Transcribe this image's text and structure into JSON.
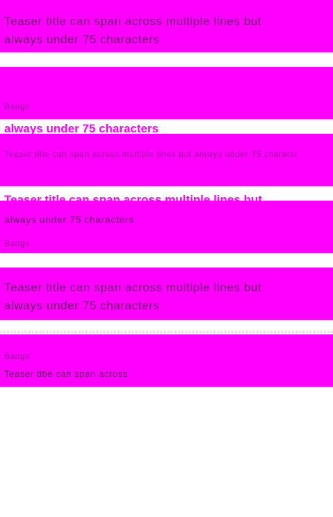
{
  "colors": {
    "accent": "#ff00ff",
    "background": "#ffffff",
    "text": "#111111"
  },
  "teasers": {
    "t1": {
      "line1": "Teaser title can span across multiple lines but",
      "line2": "always under 75 characters"
    },
    "t2": {
      "meta": "Badge"
    },
    "t3": {
      "line1": "always under 75 characters",
      "line2": "Teaser title can span across multiple lines but always under 75 characters"
    },
    "t4": {
      "line1": "Teaser title can span across multiple lines but",
      "line2": "always under 75 characters",
      "meta": "Badge"
    },
    "t5": {
      "line1": "Teaser title can span across multiple lines but",
      "line2": "always under 75 characters"
    },
    "t6": {
      "meta": "Badge",
      "line1": "Teaser title can span across"
    }
  }
}
